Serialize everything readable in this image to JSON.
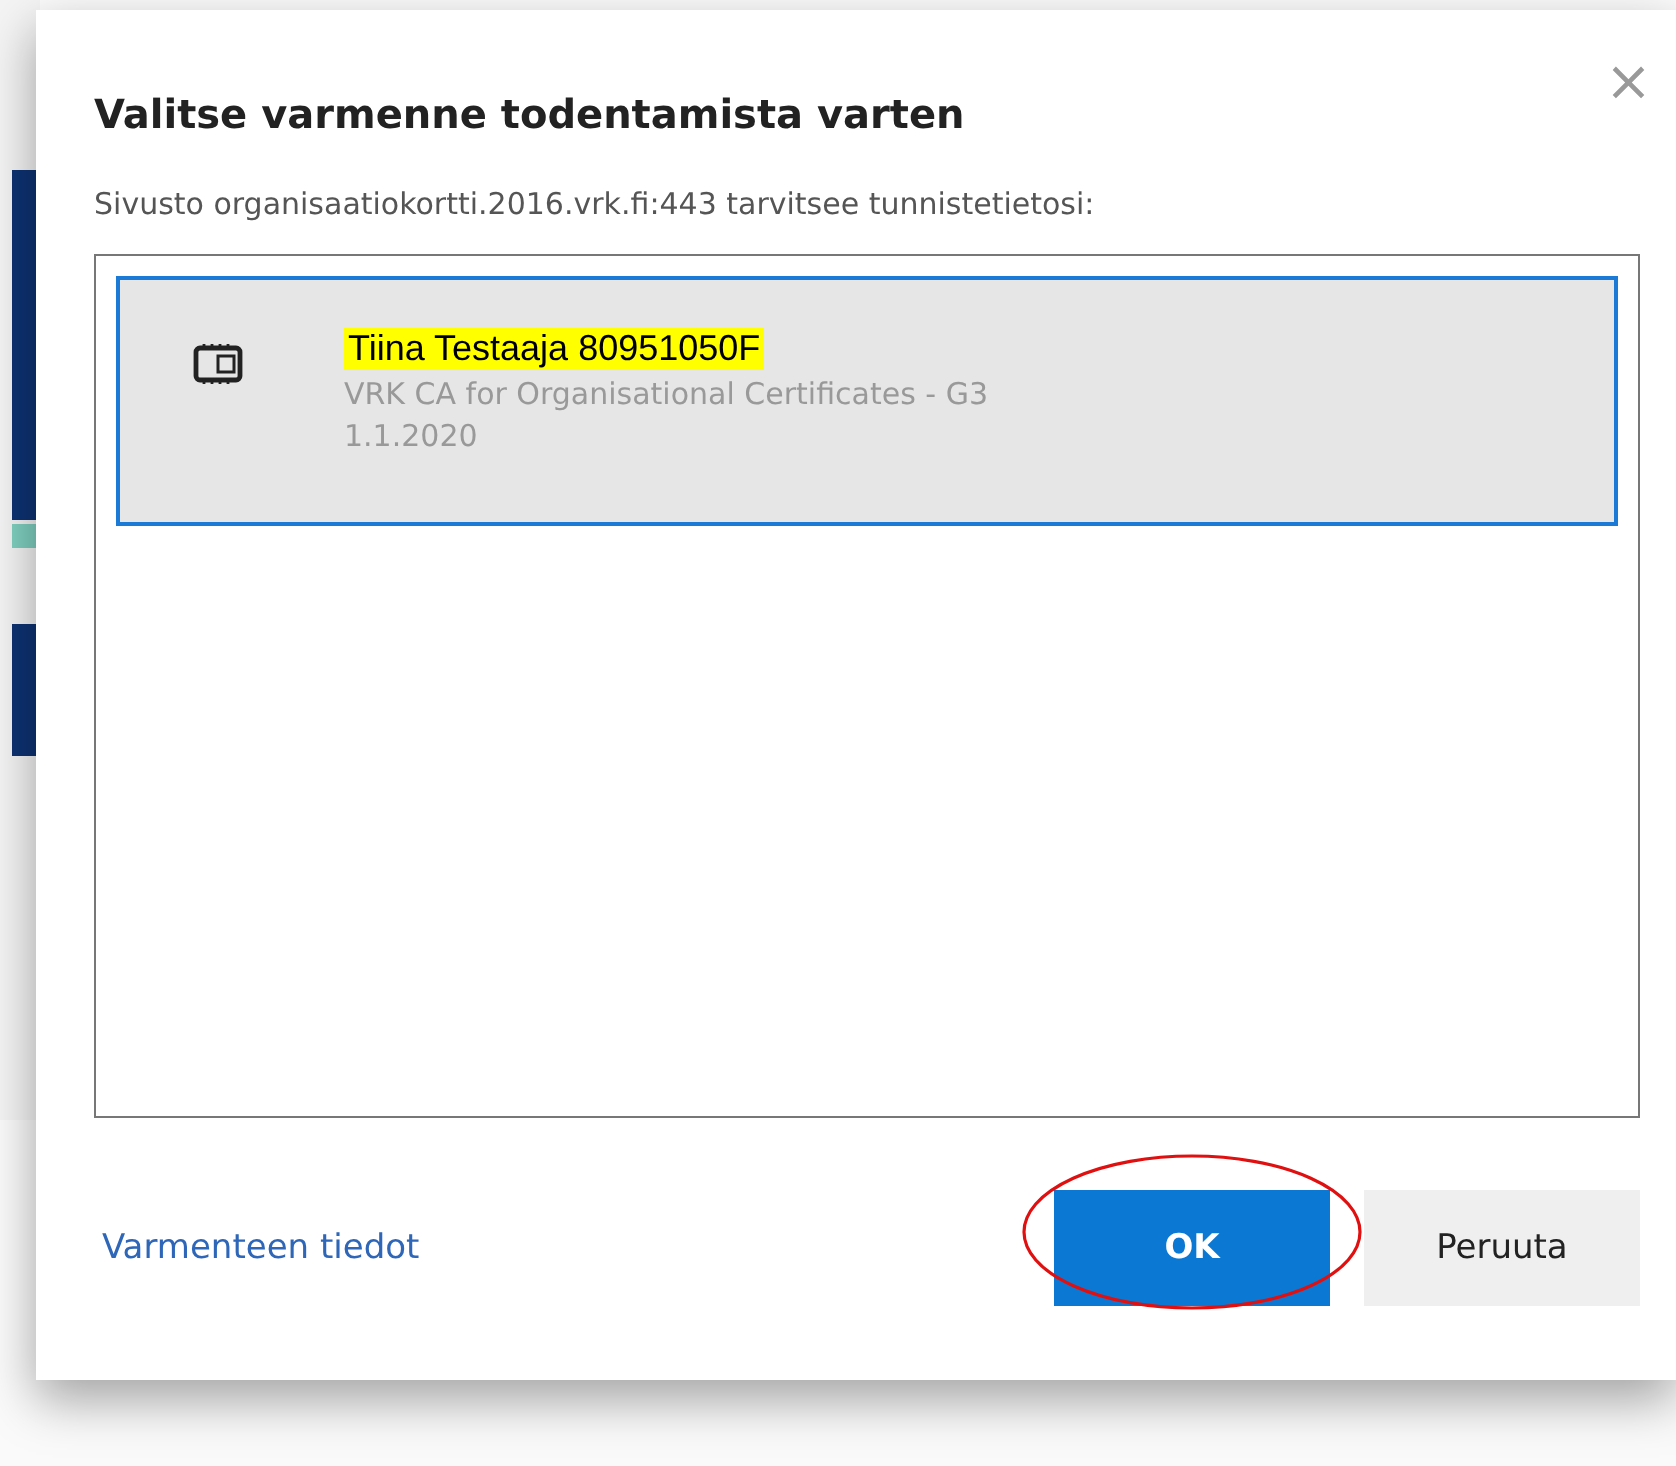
{
  "dialog": {
    "title": "Valitse varmenne todentamista varten",
    "close": "×",
    "prompt": "Sivusto organisaatiokortti.2016.vrk.fi:443 tarvitsee tunnistetietosi:"
  },
  "certificates": [
    {
      "name": "Tiina Testaaja 80951050F",
      "highlighted": true,
      "issuer": "VRK CA for Organisational Certificates - G3",
      "date": "1.1.2020",
      "selected": true
    }
  ],
  "footer": {
    "link": "Varmenteen tiedot",
    "buttons": [
      {
        "label": "OK",
        "kind": "primary",
        "circled": true
      },
      {
        "label": "Peruuta",
        "kind": "secondary",
        "circled": false
      }
    ]
  }
}
